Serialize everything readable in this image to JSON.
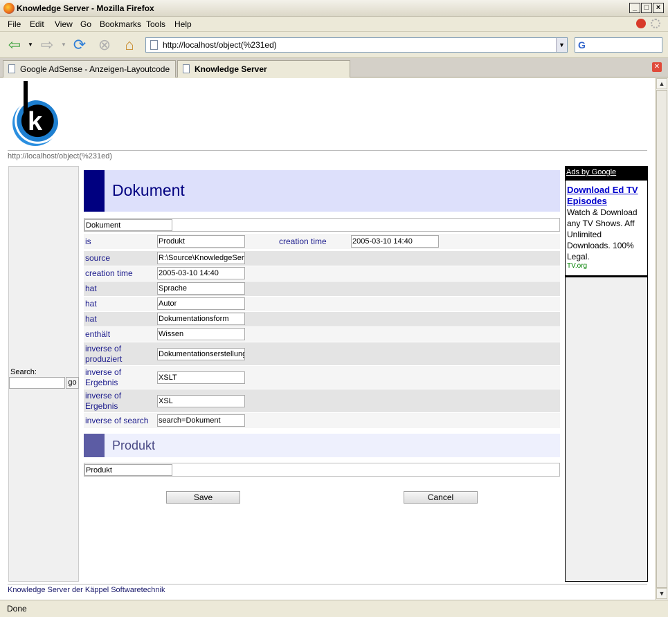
{
  "window": {
    "title": "Knowledge Server - Mozilla Firefox"
  },
  "menu": [
    "File",
    "Edit",
    "View",
    "Go",
    "Bookmarks",
    "Tools",
    "Help"
  ],
  "address": {
    "url": "http://localhost/object(%231ed)"
  },
  "tabs": [
    {
      "label": "Google AdSense - Anzeigen-Layoutcode",
      "active": false
    },
    {
      "label": "Knowledge Server",
      "active": true
    }
  ],
  "page": {
    "url_text": "http://localhost/object(%231ed)",
    "search": {
      "label": "Search:",
      "go": "go",
      "value": ""
    },
    "object": {
      "title": "Dokument",
      "name_value": "Dokument",
      "rows": [
        {
          "label": "is",
          "value": "Produkt",
          "extra_label": "creation time",
          "extra_value": "2005-03-10 14:40"
        },
        {
          "label": "source",
          "value": "R:\\Source\\KnowledgeServ"
        },
        {
          "label": "creation time",
          "value": "2005-03-10 14:40"
        },
        {
          "label": "hat",
          "value": "Sprache"
        },
        {
          "label": "hat",
          "value": "Autor"
        },
        {
          "label": "hat",
          "value": "Dokumentationsform"
        },
        {
          "label": "enthält",
          "value": "Wissen"
        },
        {
          "label": "inverse of produziert",
          "value": "Dokumentationserstellung"
        },
        {
          "label": "inverse of Ergebnis",
          "value": "XSLT"
        },
        {
          "label": "inverse of Ergebnis",
          "value": "XSL"
        },
        {
          "label": "inverse of search",
          "value": "search=Dokument"
        }
      ]
    },
    "subobject": {
      "title": "Produkt",
      "name_value": "Produkt"
    },
    "buttons": {
      "save": "Save",
      "cancel": "Cancel"
    },
    "ads": {
      "header": "Ads by Google",
      "title": "Download Ed TV Episodes",
      "text": "Watch & Download any TV Shows. Aff Unlimited Downloads. 100% Legal.",
      "url": "TV.org"
    },
    "footer": "Knowledge Server der Käppel Softwaretechnik"
  },
  "status": {
    "text": "Done"
  },
  "colors": {
    "header_dark": "#000080",
    "header_light": "#dde0fb",
    "sub_dark": "#5c5ca4",
    "label": "#1a1a8c"
  }
}
